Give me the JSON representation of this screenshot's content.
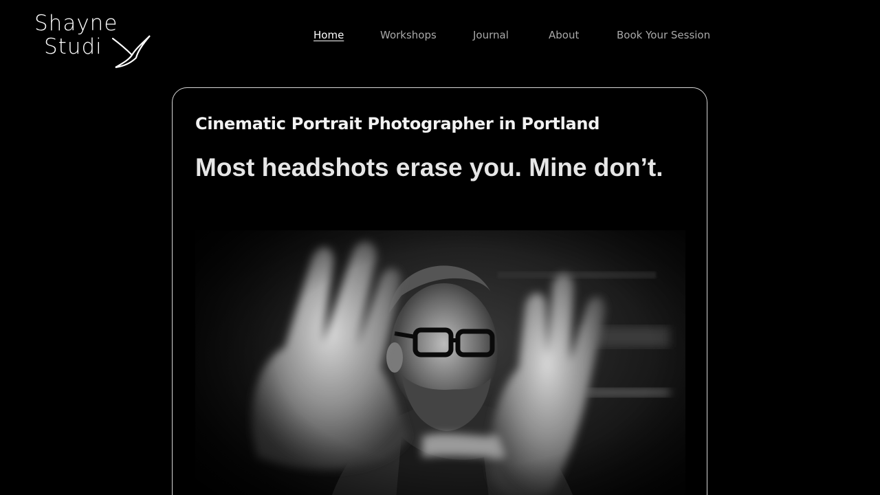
{
  "logo": {
    "line1": "Shayne",
    "line2": "Studi"
  },
  "nav": {
    "items": [
      {
        "label": "Home",
        "active": true
      },
      {
        "label": "Workshops",
        "active": false
      },
      {
        "label": "Journal",
        "active": false
      },
      {
        "label": "About",
        "active": false
      },
      {
        "label": "Book Your Session",
        "active": false
      }
    ]
  },
  "hero": {
    "subtitle": "Cinematic Portrait Photographer in Portland",
    "headline": "Most headshots erase you. Mine don’t.",
    "photo_icon": "portrait-photo"
  },
  "colors": {
    "background": "#000000",
    "card_border": "#d9d9d9",
    "nav_text": "#a9a9a9",
    "nav_active": "#ffffff"
  }
}
